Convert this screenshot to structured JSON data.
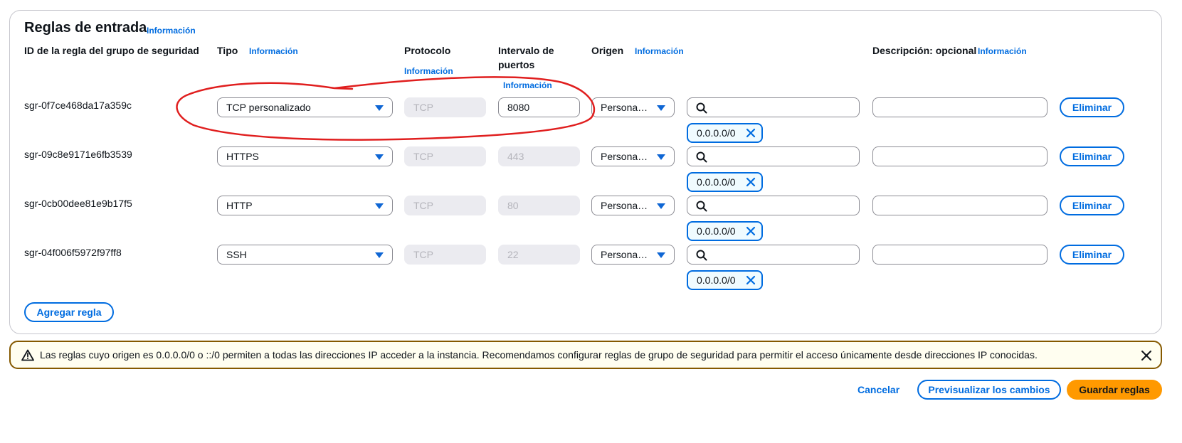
{
  "section": {
    "title": "Reglas de entrada",
    "info_label": "Información",
    "add_rule_label": "Agregar regla"
  },
  "columns": {
    "rule_id": "ID de la regla del grupo de seguridad",
    "type": "Tipo",
    "type_info": "Información",
    "protocol": "Protocolo",
    "protocol_info": "Información",
    "port_range_line1": "Intervalo de",
    "port_range_line2": "puertos",
    "port_info": "Información",
    "source": "Origen",
    "source_info": "Información",
    "description": "Descripción: opcional",
    "description_info": "Información"
  },
  "rules": [
    {
      "id": "sgr-0f7ce468da17a359c",
      "type": "TCP personalizado",
      "protocol": "TCP",
      "port": "8080",
      "source": "Persona…",
      "cidr": "0.0.0.0/0",
      "delete": "Eliminar"
    },
    {
      "id": "sgr-09c8e9171e6fb3539",
      "type": "HTTPS",
      "protocol": "TCP",
      "port": "443",
      "source": "Persona…",
      "cidr": "0.0.0.0/0",
      "delete": "Eliminar"
    },
    {
      "id": "sgr-0cb00dee81e9b17f5",
      "type": "HTTP",
      "protocol": "TCP",
      "port": "80",
      "source": "Persona…",
      "cidr": "0.0.0.0/0",
      "delete": "Eliminar"
    },
    {
      "id": "sgr-04f006f5972f97ff8",
      "type": "SSH",
      "protocol": "TCP",
      "port": "22",
      "source": "Persona…",
      "cidr": "0.0.0.0/0",
      "delete": "Eliminar"
    }
  ],
  "alert": {
    "text": "Las reglas cuyo origen es 0.0.0.0/0 o ::/0 permiten a todas las direcciones IP acceder a la instancia. Recomendamos configurar reglas de grupo de seguridad para permitir el acceso únicamente desde direcciones IP conocidas."
  },
  "footer": {
    "cancel": "Cancelar",
    "preview": "Previsualizar los cambios",
    "save": "Guardar reglas"
  },
  "colors": {
    "accent": "#006ce0",
    "primary_button": "#ff9900",
    "warning_border": "#855900",
    "annotation": "#e01e1e"
  }
}
